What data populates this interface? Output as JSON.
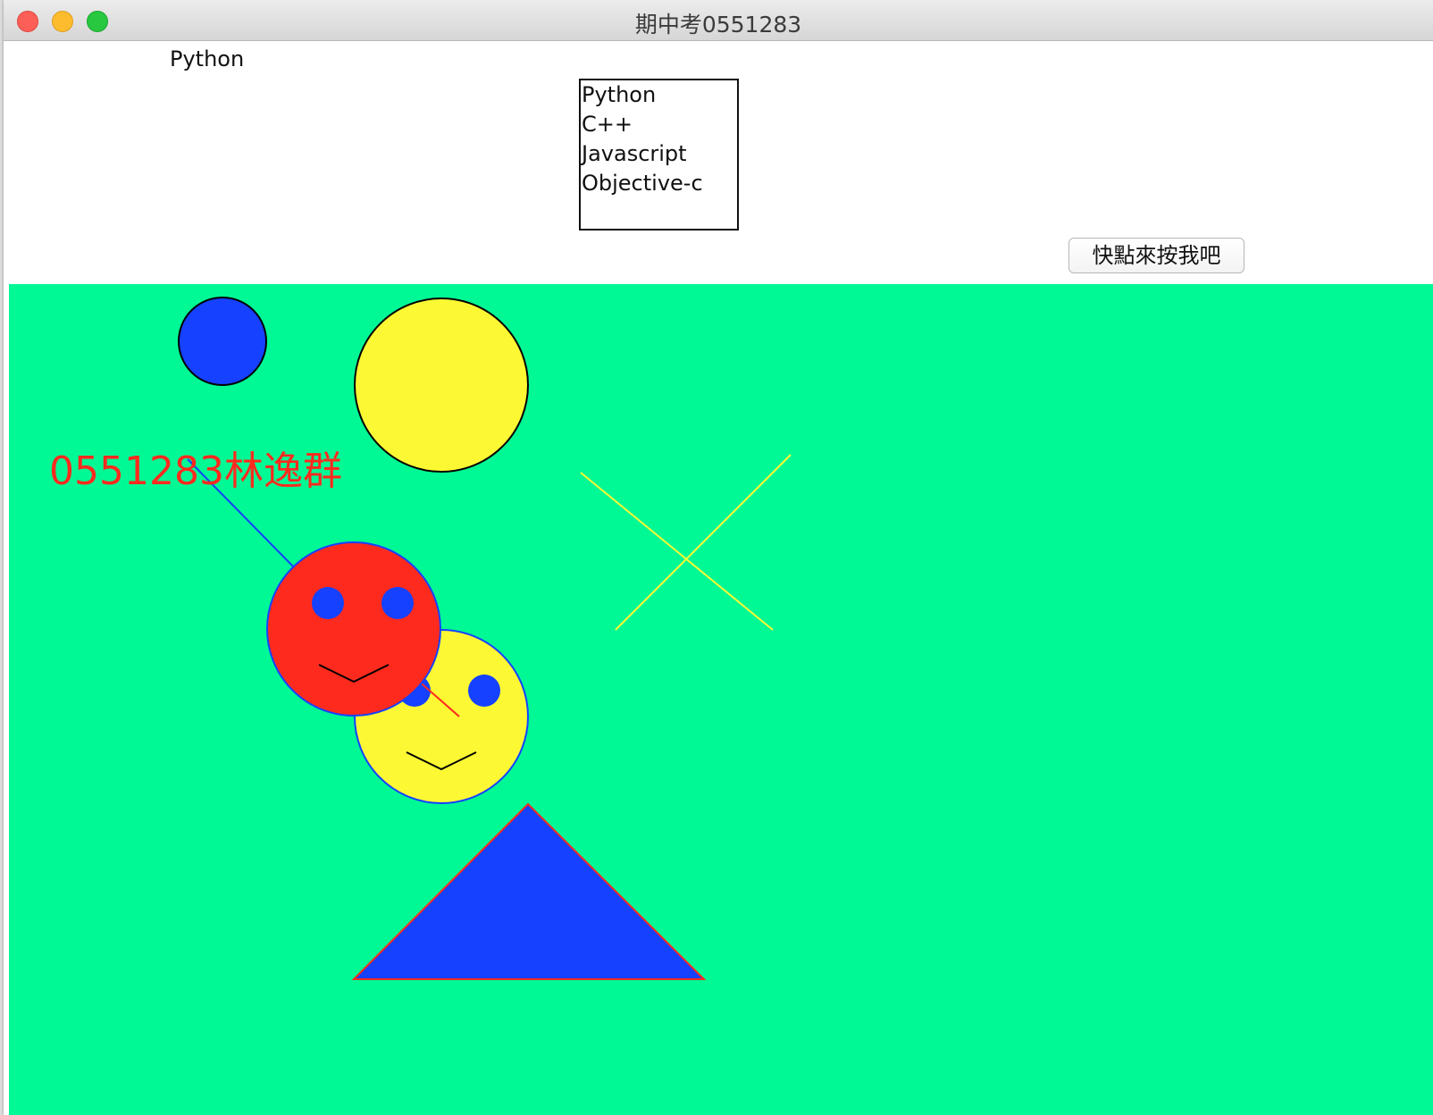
{
  "window": {
    "title": "期中考0551283"
  },
  "label": {
    "text": "Python"
  },
  "listbox": {
    "items": [
      "Python",
      "C++",
      "Javascript",
      "Objective-c"
    ]
  },
  "button": {
    "label": "快點來按我吧"
  },
  "canvas": {
    "background": "#00f995",
    "text": "0551283林逸群",
    "text_color": "#ff2a1e",
    "colors": {
      "blue": "#1541ff",
      "yellow": "#fcf934",
      "red": "#ff2a1e"
    }
  }
}
